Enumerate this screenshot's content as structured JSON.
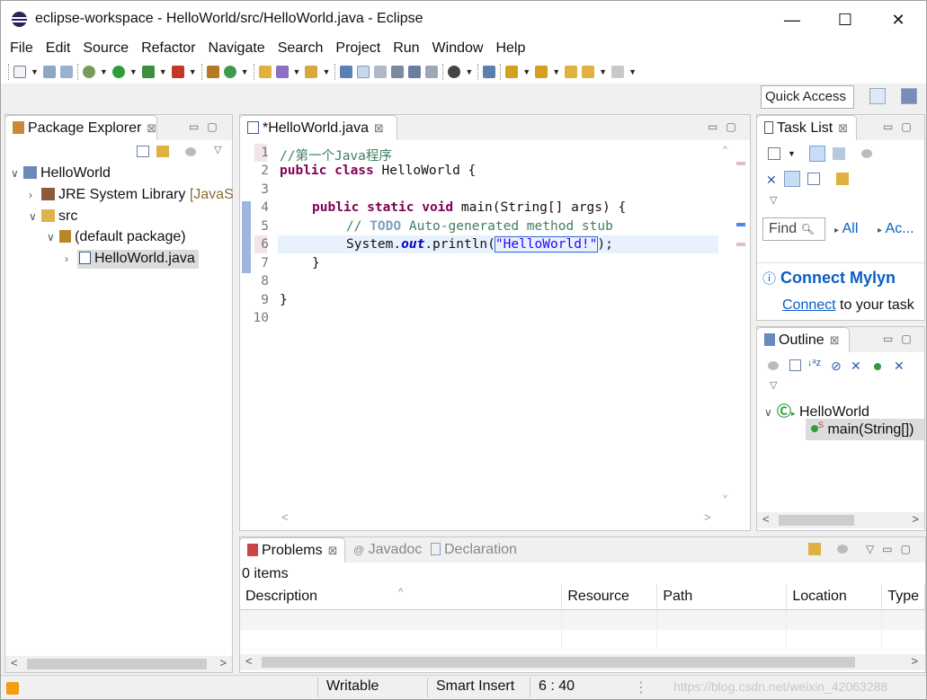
{
  "window": {
    "title": "eclipse-workspace - HelloWorld/src/HelloWorld.java - Eclipse",
    "minimize": "—",
    "maximize": "☐",
    "close": "✕"
  },
  "menu": [
    "File",
    "Edit",
    "Source",
    "Refactor",
    "Navigate",
    "Search",
    "Project",
    "Run",
    "Window",
    "Help"
  ],
  "toolbar": {
    "quick_access": "Quick Access"
  },
  "package_explorer": {
    "title": "Package Explorer",
    "tree": [
      {
        "label": "HelloWorld",
        "arrow": "∨",
        "icon": "project-icon"
      },
      {
        "label": "JRE System Library",
        "suffix": "[JavaS",
        "arrow": "›",
        "icon": "library-icon"
      },
      {
        "label": "src",
        "arrow": "∨",
        "icon": "source-folder-icon"
      },
      {
        "label": "(default package)",
        "arrow": "∨",
        "icon": "package-icon"
      },
      {
        "label": "HelloWorld.java",
        "arrow": "›",
        "icon": "java-file-icon",
        "selected": true
      }
    ]
  },
  "editor": {
    "tab_title": "*HelloWorld.java",
    "line_numbers": [
      "1",
      "2",
      "3",
      "4",
      "5",
      "6",
      "7",
      "8",
      "9",
      "10"
    ],
    "lines": {
      "l1": "//第一个Java程序",
      "l2_kw": "public class",
      "l2_rest": " HelloWorld {",
      "l4_kw": "public static void",
      "l4_rest": " main(String[] args) {",
      "l5_cm1": "// ",
      "l5_todo": "TODO",
      "l5_cm2": " Auto-generated method stub",
      "l6_a": "System.",
      "l6_out": "out",
      "l6_b": ".println(",
      "l6_str": "\"HelloWorld!\"",
      "l6_c": ");",
      "l7": "}",
      "l9": "}"
    }
  },
  "task_list": {
    "title": "Task List",
    "find": "Find",
    "all": "All",
    "ac": "Ac...",
    "mylyn_title": "Connect Mylyn",
    "mylyn_link": "Connect",
    "mylyn_rest": " to your task"
  },
  "outline": {
    "title": "Outline",
    "class_name": "HelloWorld",
    "method": "main(String[])"
  },
  "problems": {
    "tabs": [
      "Problems",
      "Javadoc",
      "Declaration"
    ],
    "items_count": "0 items",
    "columns": [
      "Description",
      "Resource",
      "Path",
      "Location",
      "Type"
    ]
  },
  "status": {
    "writable": "Writable",
    "insert_mode": "Smart Insert",
    "position": "6 : 40",
    "watermark": "https://blog.csdn.net/weixin_42063288"
  },
  "colors": {
    "keyword": "#7f0055",
    "comment": "#3f7f5f",
    "string": "#2a00ff",
    "link": "#0b5ec7",
    "selection": "#e8f2fe"
  }
}
